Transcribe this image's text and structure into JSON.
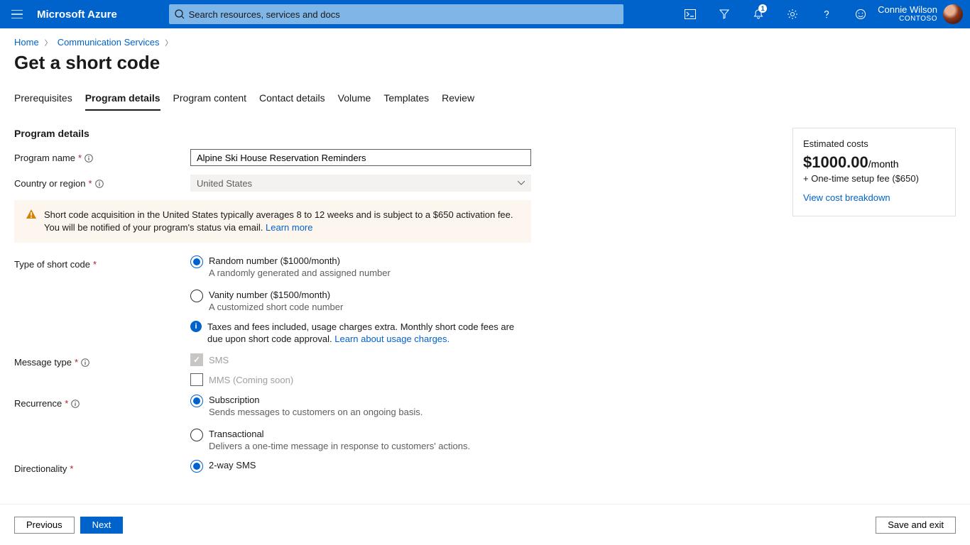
{
  "header": {
    "brand": "Microsoft Azure",
    "search_placeholder": "Search resources, services and docs",
    "notif_count": "1",
    "user_name": "Connie Wilson",
    "org": "CONTOSO"
  },
  "breadcrumb": {
    "home": "Home",
    "comm": "Communication Services"
  },
  "page_title": "Get a short code",
  "tabs": [
    "Prerequisites",
    "Program details",
    "Program content",
    "Contact details",
    "Volume",
    "Templates",
    "Review"
  ],
  "section_heading": "Program details",
  "fields": {
    "program_name_label": "Program name",
    "program_name_value": "Alpine Ski House Reservation Reminders",
    "country_label": "Country or region",
    "country_value": "United States"
  },
  "alert": {
    "text": "Short code acquisition in the United States typically averages 8 to 12 weeks and is subject to a $650 activation fee. You will be notified of your program's status via email. ",
    "link": "Learn more"
  },
  "type_label": "Type of short code",
  "type_options": {
    "random_label": "Random number ($1000/month)",
    "random_desc": "A randomly generated and assigned number",
    "vanity_label": "Vanity number ($1500/month)",
    "vanity_desc": "A customized short code number"
  },
  "type_note": {
    "text": "Taxes and fees included, usage charges extra. Monthly short code fees are due upon short code approval. ",
    "link": "Learn about usage charges."
  },
  "message_type": {
    "label": "Message type",
    "sms": "SMS",
    "mms": "MMS (Coming soon)"
  },
  "recurrence": {
    "label": "Recurrence",
    "sub_label": "Subscription",
    "sub_desc": "Sends messages to customers on an ongoing basis.",
    "trans_label": "Transactional",
    "trans_desc": "Delivers a one-time message in response to customers' actions."
  },
  "directionality": {
    "label": "Directionality",
    "twoway_label": "2-way SMS"
  },
  "cost": {
    "title": "Estimated costs",
    "amount": "$1000.00",
    "period": "/month",
    "fee": "+ One-time setup fee ($650)",
    "link": "View cost breakdown"
  },
  "footer": {
    "previous": "Previous",
    "next": "Next",
    "save_exit": "Save and exit"
  }
}
